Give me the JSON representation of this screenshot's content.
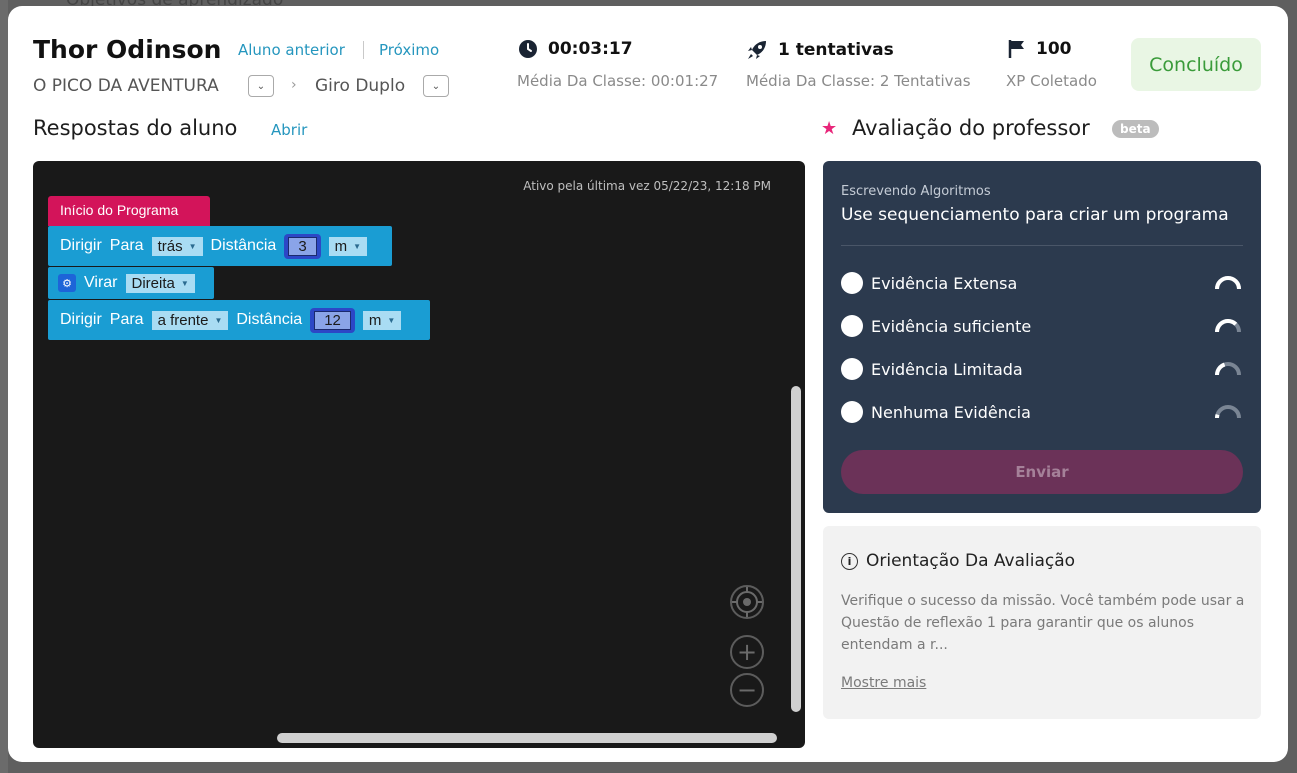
{
  "background": {
    "top_text": "Objetivos de aprendizado"
  },
  "header": {
    "student_name": "Thor Odinson",
    "prev_label": "Aluno anterior",
    "next_label": "Próximo",
    "course": "O PICO DA AVENTURA",
    "lesson": "Giro Duplo",
    "time_value": "00:03:17",
    "time_avg": "Média Da Classe: 00:01:27",
    "attempts_value": "1 tentativas",
    "attempts_avg": "Média Da Classe: 2 Tentativas",
    "xp_value": "100",
    "xp_label": "XP Coletado",
    "status": "Concluído"
  },
  "responses": {
    "title": "Respostas do aluno",
    "open_label": "Abrir",
    "last_active": "Ativo pela última vez 05/22/23, 12:18 PM",
    "start_block": "Início do Programa",
    "blocks": [
      {
        "cmd": "Dirigir",
        "dir_label": "Para",
        "dir": "trás",
        "dist_label": "Distância",
        "dist": "3",
        "unit": "m"
      },
      {
        "cmd": "Virar",
        "dir": "Direita"
      },
      {
        "cmd": "Dirigir",
        "dir_label": "Para",
        "dir": "a frente",
        "dist_label": "Distância",
        "dist": "12",
        "unit": "m"
      }
    ]
  },
  "evaluation": {
    "title": "Avaliação do professor",
    "badge": "beta",
    "category": "Escrevendo Algoritmos",
    "description": "Use sequenciamento para criar um programa",
    "options": [
      {
        "label": "Evidência Extensa",
        "level": 1.0
      },
      {
        "label": "Evidência suficiente",
        "level": 0.75
      },
      {
        "label": "Evidência Limitada",
        "level": 0.4
      },
      {
        "label": "Nenhuma Evidência",
        "level": 0.1
      }
    ],
    "submit_label": "Enviar"
  },
  "guidance": {
    "title": "Orientação Da Avaliação",
    "text": "Verifique o sucesso da missão. Você também pode usar a Questão de reflexão 1 para garantir que os alunos entendam a r...",
    "more_label": "Mostre mais"
  },
  "colors": {
    "accent_link": "#2596be",
    "status_green": "#3a9b3a",
    "start_block": "#d3145a",
    "motion_block": "#1a9dd3",
    "eval_bg": "#2c3a4e",
    "submit_bg": "#6b3258",
    "star_pink": "#e8267a"
  }
}
